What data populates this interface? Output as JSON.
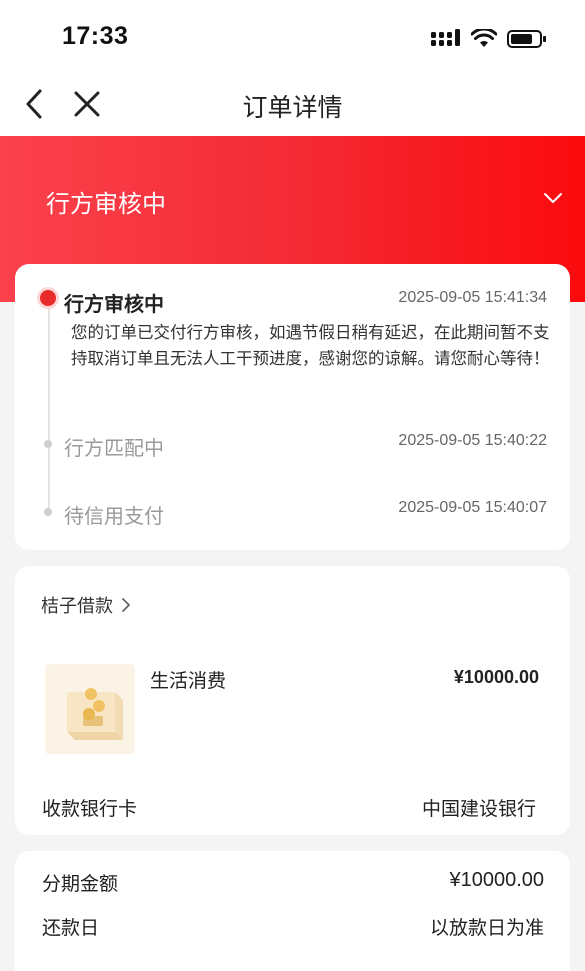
{
  "status_bar": {
    "time": "17:33"
  },
  "nav": {
    "title": "订单详情"
  },
  "header": {
    "status_title": "行方审核中"
  },
  "timeline": [
    {
      "title": "行方审核中",
      "time": "2025-09-05 15:41:34",
      "active": true,
      "description": "您的订单已交付行方审核，如遇节假日稍有延迟，在此期间暂不支持取消订单且无法人工干预进度，感谢您的谅解。请您耐心等待！"
    },
    {
      "title": "行方匹配中",
      "time": "2025-09-05 15:40:22",
      "active": false
    },
    {
      "title": "待信用支付",
      "time": "2025-09-05 15:40:07",
      "active": false
    }
  ],
  "loan": {
    "provider": "桔子借款",
    "purpose": "生活消费",
    "amount": "¥10000.00",
    "bank_card_label": "收款银行卡",
    "bank_card_value": "中国建设银行"
  },
  "terms": {
    "installment_label": "分期金额",
    "installment_value": "¥10000.00",
    "repay_day_label": "还款日",
    "repay_day_value": "以放款日为准"
  },
  "colors": {
    "accent": "#e82b2b",
    "header_start": "#fb414c",
    "header_end": "#fb0a0d"
  }
}
